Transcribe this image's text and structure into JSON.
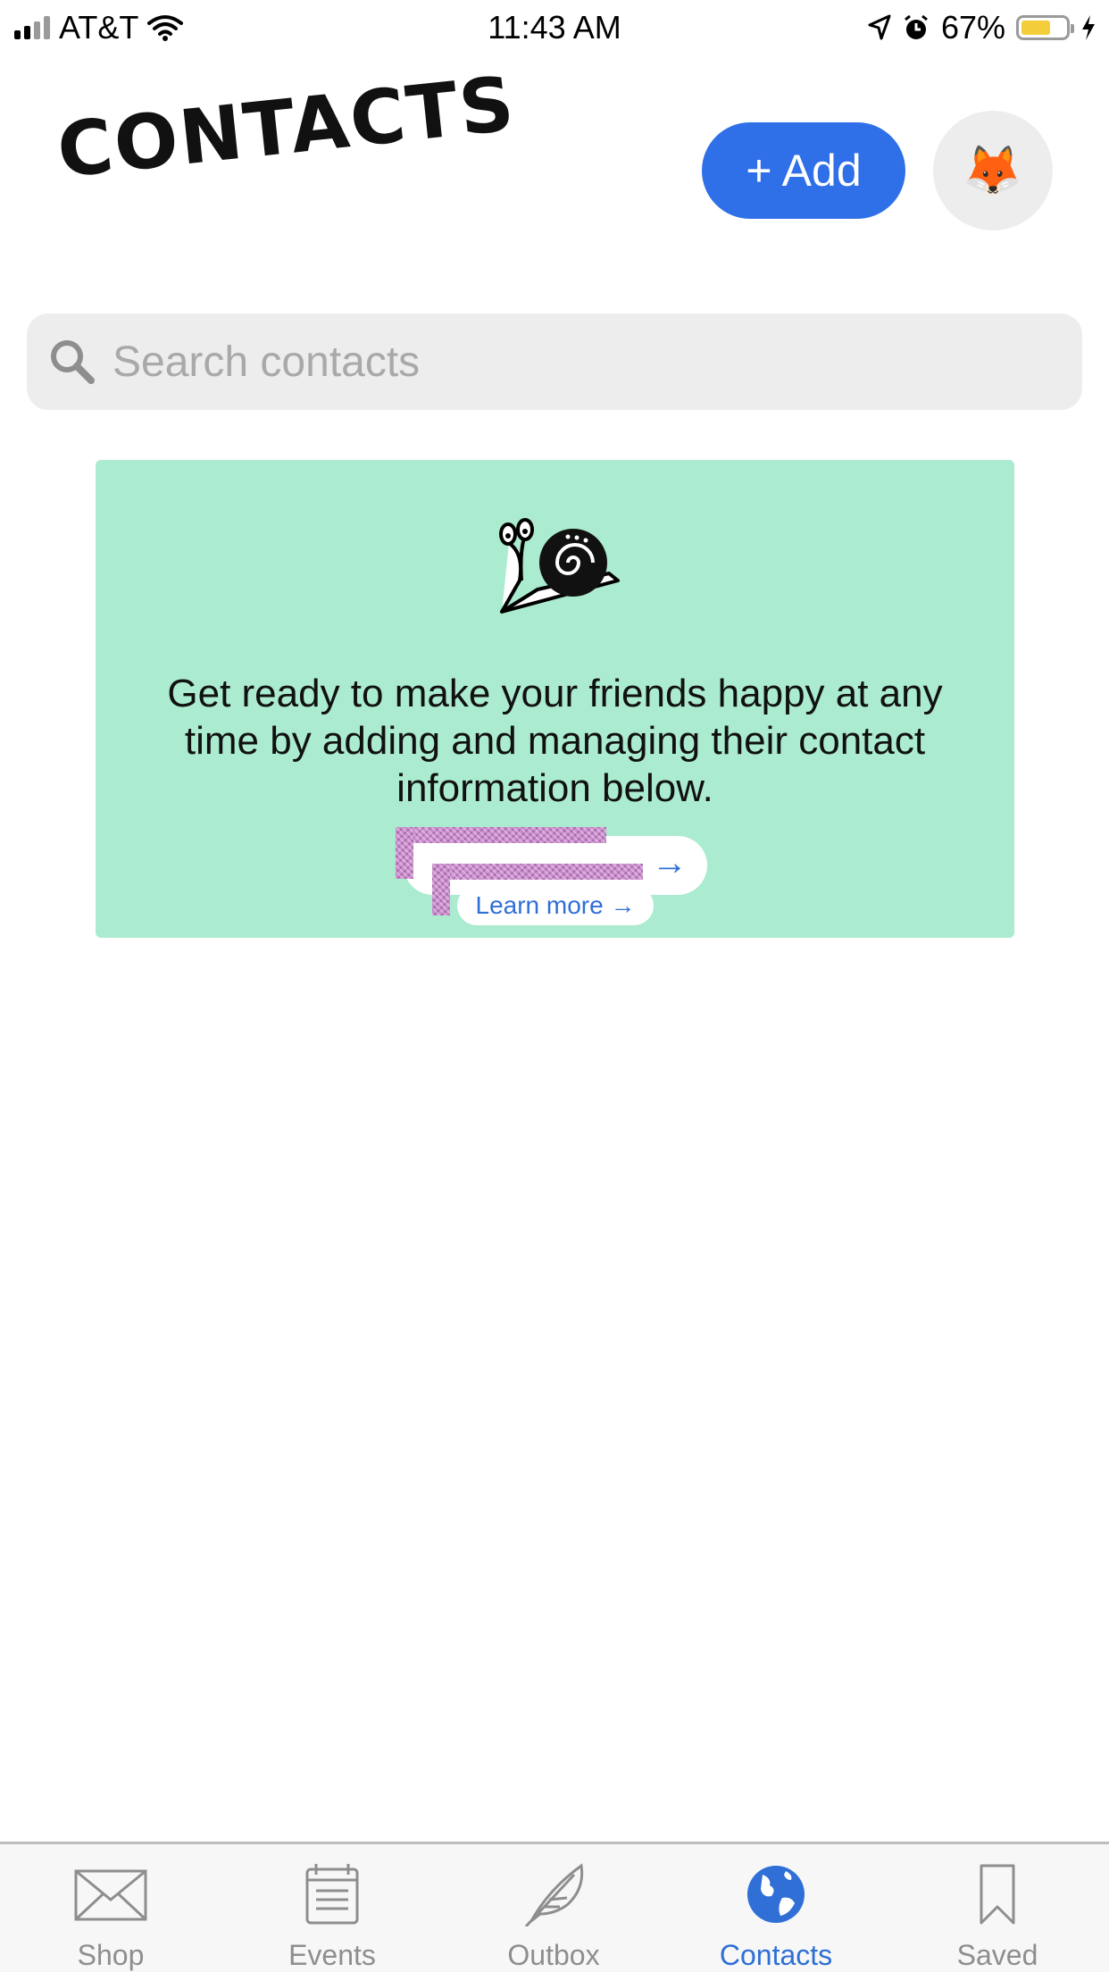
{
  "status_bar": {
    "carrier": "AT&T",
    "time": "11:43 AM",
    "battery": "67%",
    "battery_level": 0.67,
    "icons": [
      "signal-icon",
      "wifi-icon",
      "location-icon",
      "alarm-icon",
      "battery-icon",
      "charging-icon"
    ]
  },
  "header": {
    "title": "CONTACTS",
    "add_label": "+ Add",
    "avatar_emoji": "🦊"
  },
  "search": {
    "placeholder": "Search contacts"
  },
  "promo": {
    "text": "Get ready to make your friends happy at any time by adding and managing their contact information below.",
    "back_pill_arrow": "→",
    "learn_more_label": "Learn more →"
  },
  "tab_bar": {
    "items": [
      {
        "label": "Shop",
        "icon": "envelope-icon"
      },
      {
        "label": "Events",
        "icon": "calendar-icon"
      },
      {
        "label": "Outbox",
        "icon": "feather-icon"
      },
      {
        "label": "Contacts",
        "icon": "globe-icon",
        "active": true
      },
      {
        "label": "Saved",
        "icon": "bookmark-icon"
      }
    ]
  },
  "colors": {
    "accent": "#2f6fe8",
    "promo_bg": "#abebcf",
    "tab_active": "#2f6fd6",
    "tab_inactive": "#8e8e8e"
  }
}
